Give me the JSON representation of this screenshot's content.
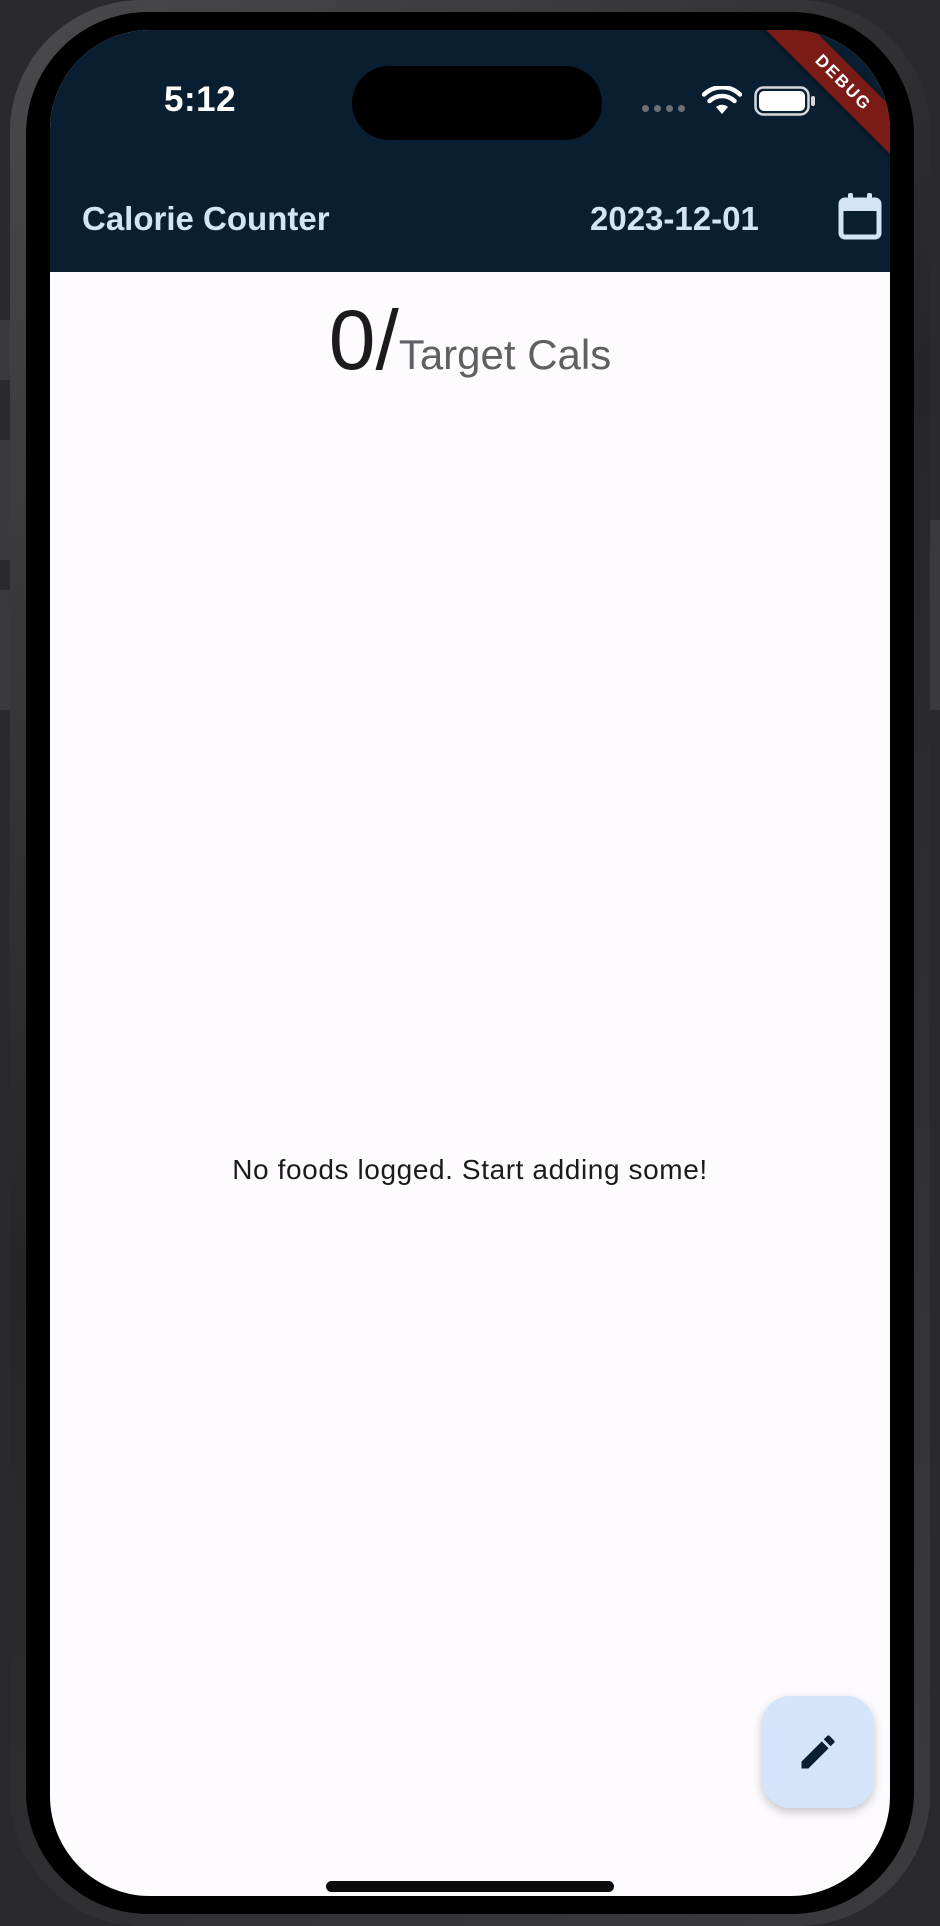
{
  "status_bar": {
    "time": "5:12",
    "icons": [
      "cellular-signal-icon",
      "wifi-icon",
      "battery-icon"
    ]
  },
  "debug_banner": "DEBUG",
  "app_bar": {
    "title": "Calorie Counter",
    "date": "2023-12-01",
    "action_icon": "calendar-icon"
  },
  "summary": {
    "consumed": "0",
    "separator": "/",
    "target_label": "Target Cals"
  },
  "empty_state": {
    "message": "No foods logged. Start adding some!"
  },
  "fab": {
    "icon": "edit-icon"
  },
  "colors": {
    "app_bar_background": "#0a1e31",
    "app_bar_text": "#d4e4f7",
    "body_background": "#fdfbfe",
    "fab_background": "#d3e4fb",
    "fab_icon": "#0a1e31",
    "debug_ribbon": "#7a1b16"
  }
}
